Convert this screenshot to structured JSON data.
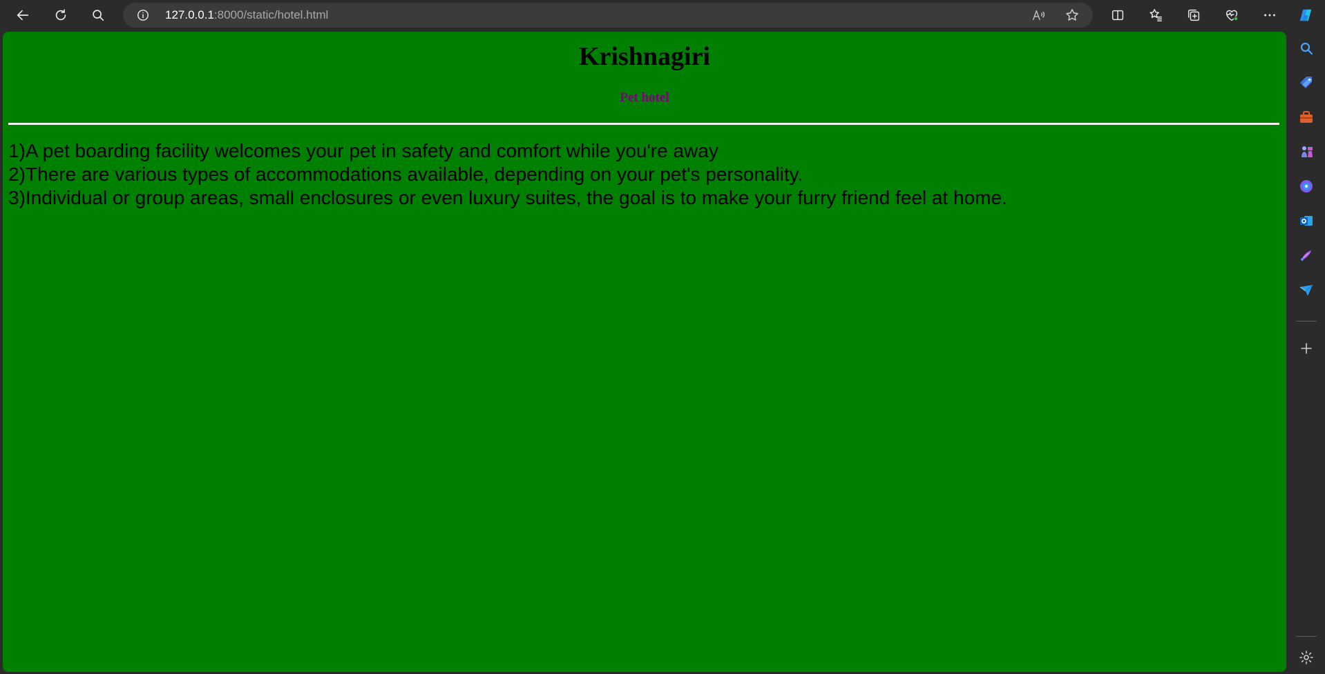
{
  "browser": {
    "address_bar": {
      "url_host": "127.0.0.1",
      "url_rest": ":8000/static/hotel.html"
    },
    "toolbar_icons": [
      "back-icon",
      "refresh-icon",
      "search-icon",
      "site-info-icon",
      "read-aloud-icon",
      "favorite-star-icon",
      "split-screen-icon",
      "favorites-icon",
      "collections-icon",
      "browser-essentials-icon",
      "more-options-icon",
      "copilot-icon"
    ],
    "sidebar_icons": [
      "search-icon",
      "shopping-tag-icon",
      "tools-icon",
      "games-icon",
      "copilot-app-icon",
      "outlook-icon",
      "designer-icon",
      "send-icon",
      "add-icon",
      "settings-icon"
    ]
  },
  "page": {
    "title": "Krishnagiri",
    "subtitle": "Pet hotel",
    "items": [
      "1)A pet boarding facility welcomes your pet in safety and comfort while you're away",
      "2)There are various types of accommodations available, depending on your pet's personality.",
      "3)Individual or group areas, small enclosures or even luxury suites, the goal is to make your furry friend feel at home."
    ]
  },
  "colors": {
    "page_background": "#008000",
    "subtitle": "#800080",
    "browser_chrome": "#2b2b2b",
    "address_bar": "#3b3b3b"
  }
}
